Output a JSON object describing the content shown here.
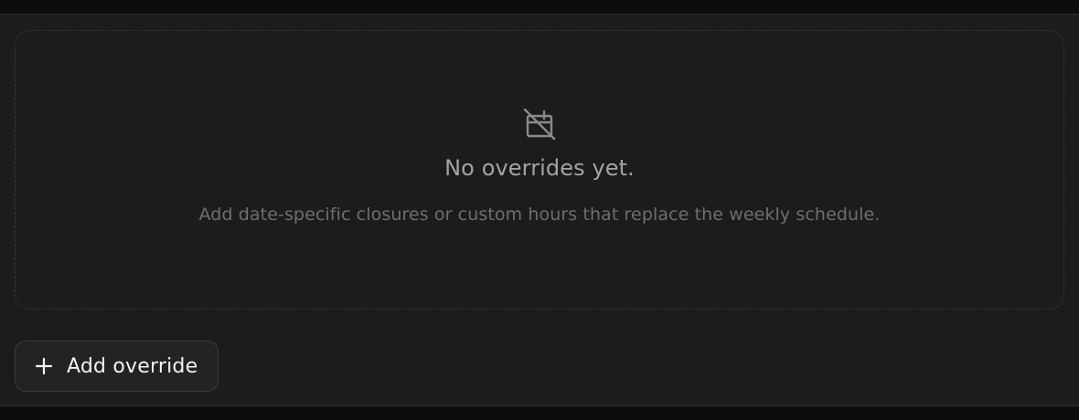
{
  "overrides": {
    "empty_state": {
      "icon": "calendar-off-icon",
      "title": "No overrides yet.",
      "description": "Add date-specific closures or custom hours that replace the weekly schedule."
    },
    "add_button": {
      "icon": "plus-icon",
      "label": "Add override"
    }
  },
  "colors": {
    "panel_background": "#1c1c1c",
    "title_text": "#a3a3a3",
    "description_text": "#6e6e6e",
    "button_text": "#f2f2f2"
  }
}
